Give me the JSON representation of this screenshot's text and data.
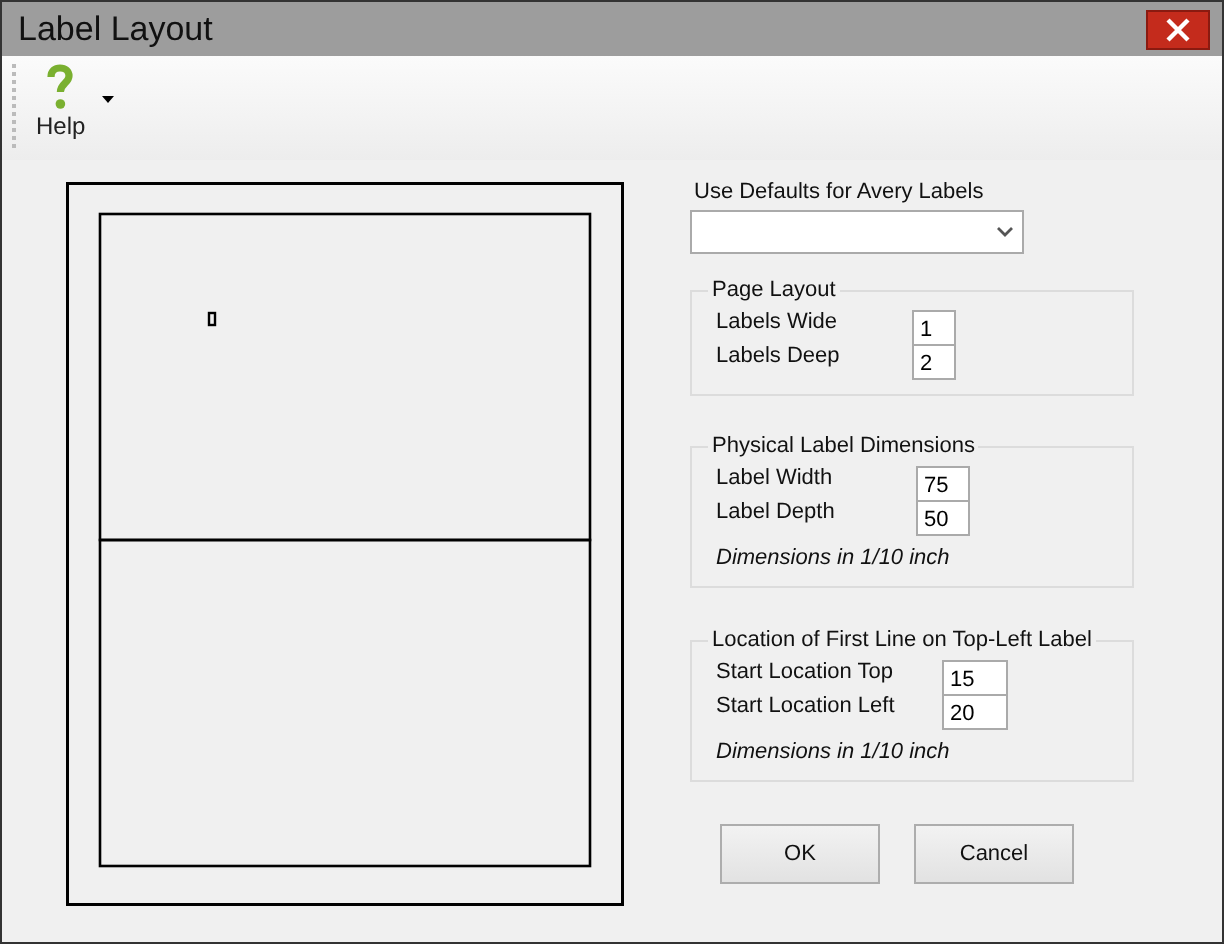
{
  "window": {
    "title": "Label Layout"
  },
  "toolbar": {
    "items": [
      {
        "label": "Help",
        "has_dropdown": true
      }
    ]
  },
  "avery": {
    "label": "Use Defaults for Avery Labels"
  },
  "groups": [
    {
      "title": "Page Layout",
      "fields": [
        {
          "label": "Labels Wide",
          "value": "1"
        },
        {
          "label": "Labels Deep",
          "value": "2"
        }
      ]
    },
    {
      "title": "Physical Label Dimensions",
      "fields": [
        {
          "label": "Label Width",
          "value": "75"
        },
        {
          "label": "Label Depth",
          "value": "50"
        }
      ],
      "note": "Dimensions in 1/10 inch"
    },
    {
      "title": "Location of First Line on Top-Left Label",
      "fields": [
        {
          "label": "Start Location Top",
          "value": "15"
        },
        {
          "label": "Start Location Left",
          "value": "20"
        }
      ],
      "note": "Dimensions in 1/10 inch"
    }
  ],
  "buttons": [
    "OK",
    "Cancel"
  ]
}
